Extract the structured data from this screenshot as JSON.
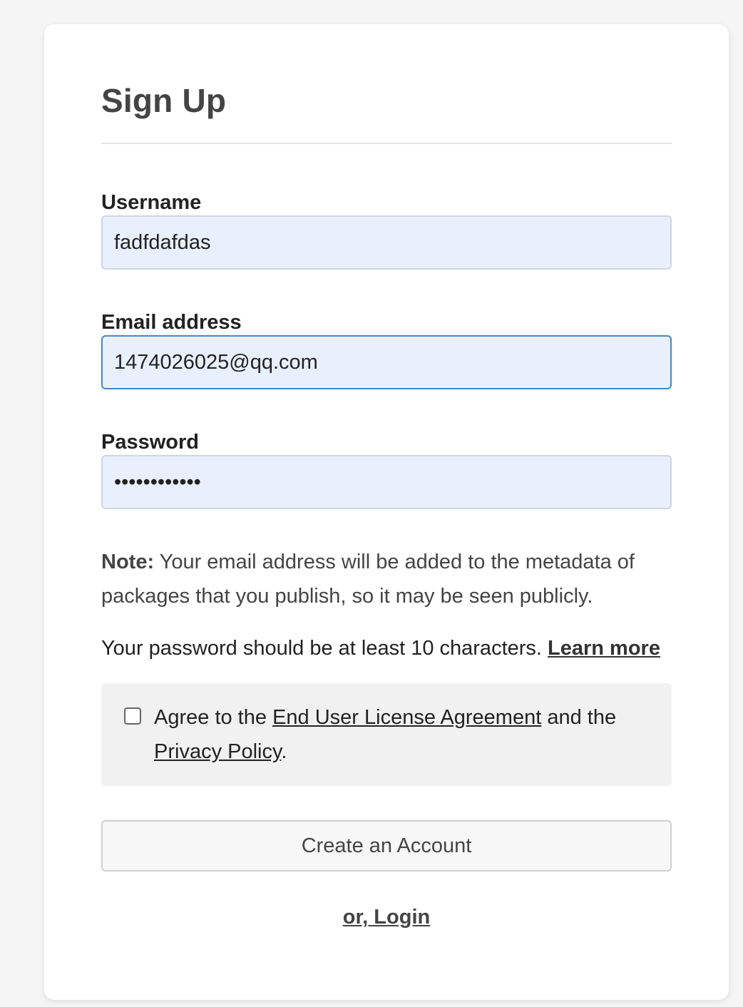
{
  "form": {
    "title": "Sign Up",
    "username": {
      "label": "Username",
      "value": "fadfdafdas"
    },
    "email": {
      "label": "Email address",
      "value": "1474026025@qq.com"
    },
    "password": {
      "label": "Password",
      "value": "••••••••••••"
    },
    "note": {
      "prefix": "Note:",
      "text": " Your email address will be added to the metadata of packages that you publish, so it may be seen publicly."
    },
    "password_rule": {
      "text": "Your password should be at least 10 characters. ",
      "link": "Learn more"
    },
    "agreement": {
      "prefix": "Agree to the ",
      "eula_link": "End User License Agreement",
      "middle": " and the ",
      "privacy_link": "Privacy Policy",
      "suffix": ".",
      "checked": false
    },
    "submit_label": "Create an Account",
    "login_link": "or, Login"
  },
  "colors": {
    "background": "#f5f5f5",
    "card": "#ffffff",
    "input_fill": "#e8f0fe",
    "focus_border": "#4a86c8",
    "agree_box": "#f1f1f1"
  }
}
